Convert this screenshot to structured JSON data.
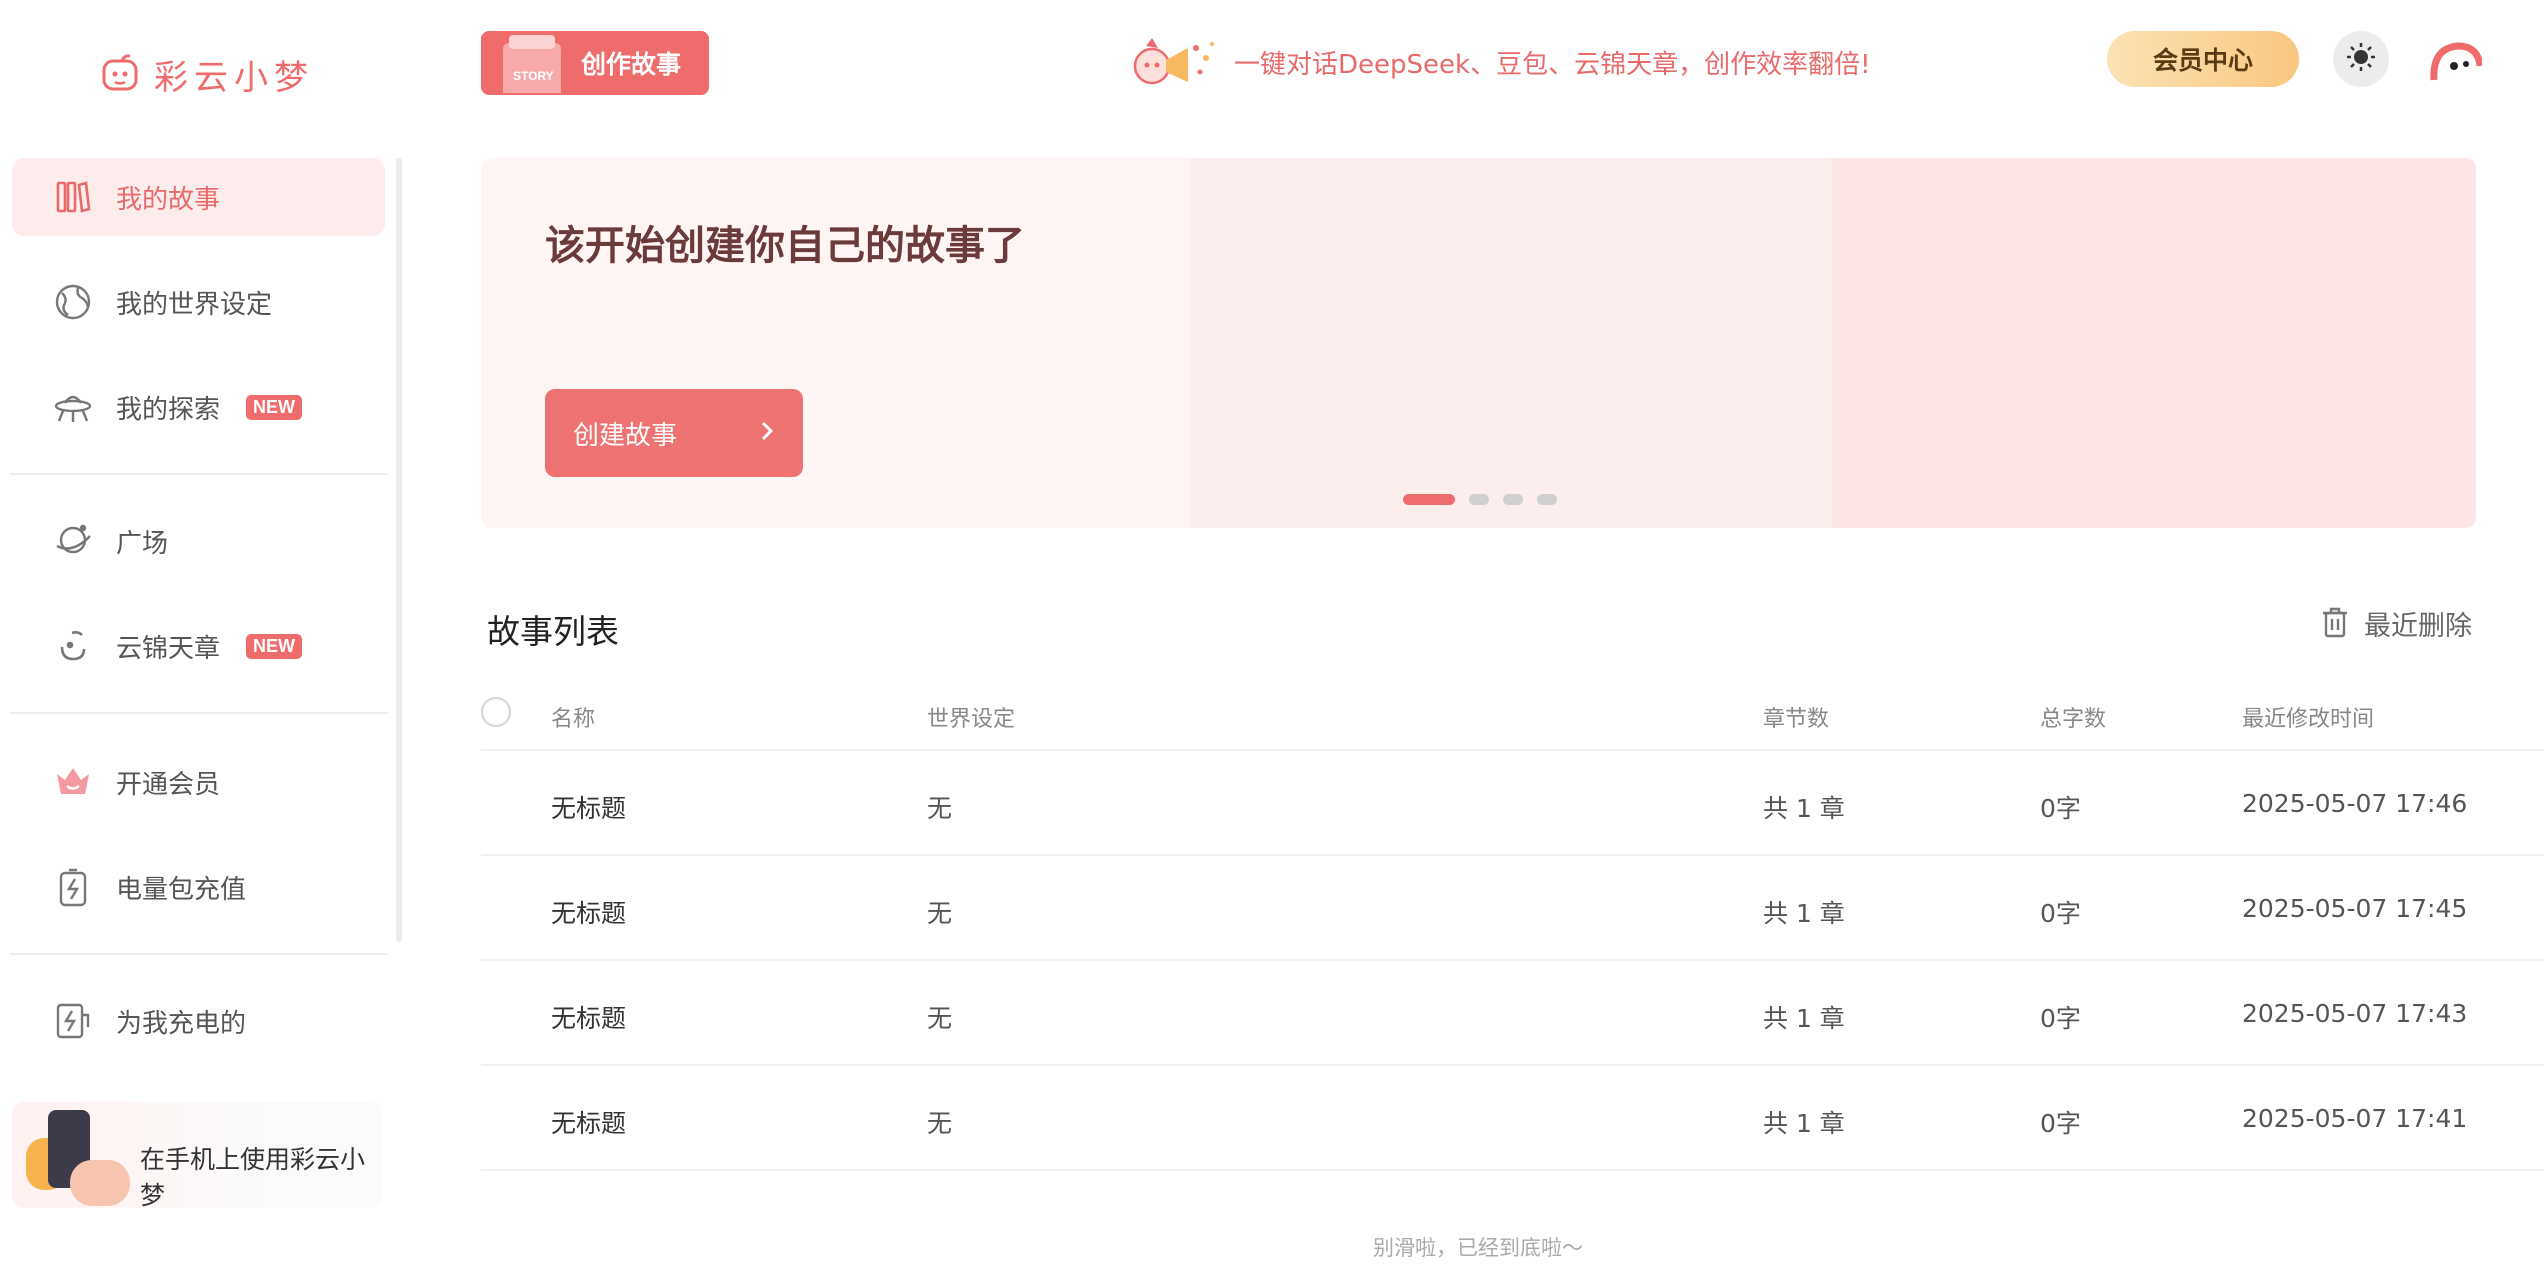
{
  "app": {
    "logo_text": "彩云小梦"
  },
  "sidebar": {
    "items": [
      {
        "label": "我的故事",
        "icon": "books-icon",
        "badge": ""
      },
      {
        "label": "我的世界设定",
        "icon": "globe-icon",
        "badge": ""
      },
      {
        "label": "我的探索",
        "icon": "ufo-icon",
        "badge": "NEW"
      },
      {
        "label": "广场",
        "icon": "planet-icon",
        "badge": ""
      },
      {
        "label": "云锦天章",
        "icon": "swirl-icon",
        "badge": "NEW"
      },
      {
        "label": "开通会员",
        "icon": "crown-icon",
        "badge": ""
      },
      {
        "label": "电量包充值",
        "icon": "battery-icon",
        "badge": ""
      },
      {
        "label": "为我充电的",
        "icon": "charge-icon",
        "badge": ""
      }
    ],
    "mobile_card": "在手机上使用彩云小梦"
  },
  "header": {
    "create_story": "创作故事",
    "story_tag": "STORY",
    "promo": "一键对话DeepSeek、豆包、云锦天章，创作效率翻倍!",
    "vip_center": "会员中心"
  },
  "banner": {
    "title": "该开始创建你自己的故事了",
    "button": "创建故事",
    "slides": 4,
    "active_slide": 1
  },
  "story_list": {
    "title": "故事列表",
    "recent_delete": "最近删除",
    "columns": {
      "name": "名称",
      "world": "世界设定",
      "chapters": "章节数",
      "words": "总字数",
      "modified": "最近修改时间"
    },
    "rows": [
      {
        "name": "无标题",
        "world": "无",
        "chapters": "共 1 章",
        "words": "0字",
        "modified": "2025-05-07 17:46"
      },
      {
        "name": "无标题",
        "world": "无",
        "chapters": "共 1 章",
        "words": "0字",
        "modified": "2025-05-07 17:45"
      },
      {
        "name": "无标题",
        "world": "无",
        "chapters": "共 1 章",
        "words": "0字",
        "modified": "2025-05-07 17:43"
      },
      {
        "name": "无标题",
        "world": "无",
        "chapters": "共 1 章",
        "words": "0字",
        "modified": "2025-05-07 17:41"
      }
    ],
    "end_note": "别滑啦，已经到底啦～"
  },
  "colors": {
    "accent": "#ee6c6c",
    "vip_gold": "#f9c77f",
    "banner_bg": "#fdeeee"
  }
}
